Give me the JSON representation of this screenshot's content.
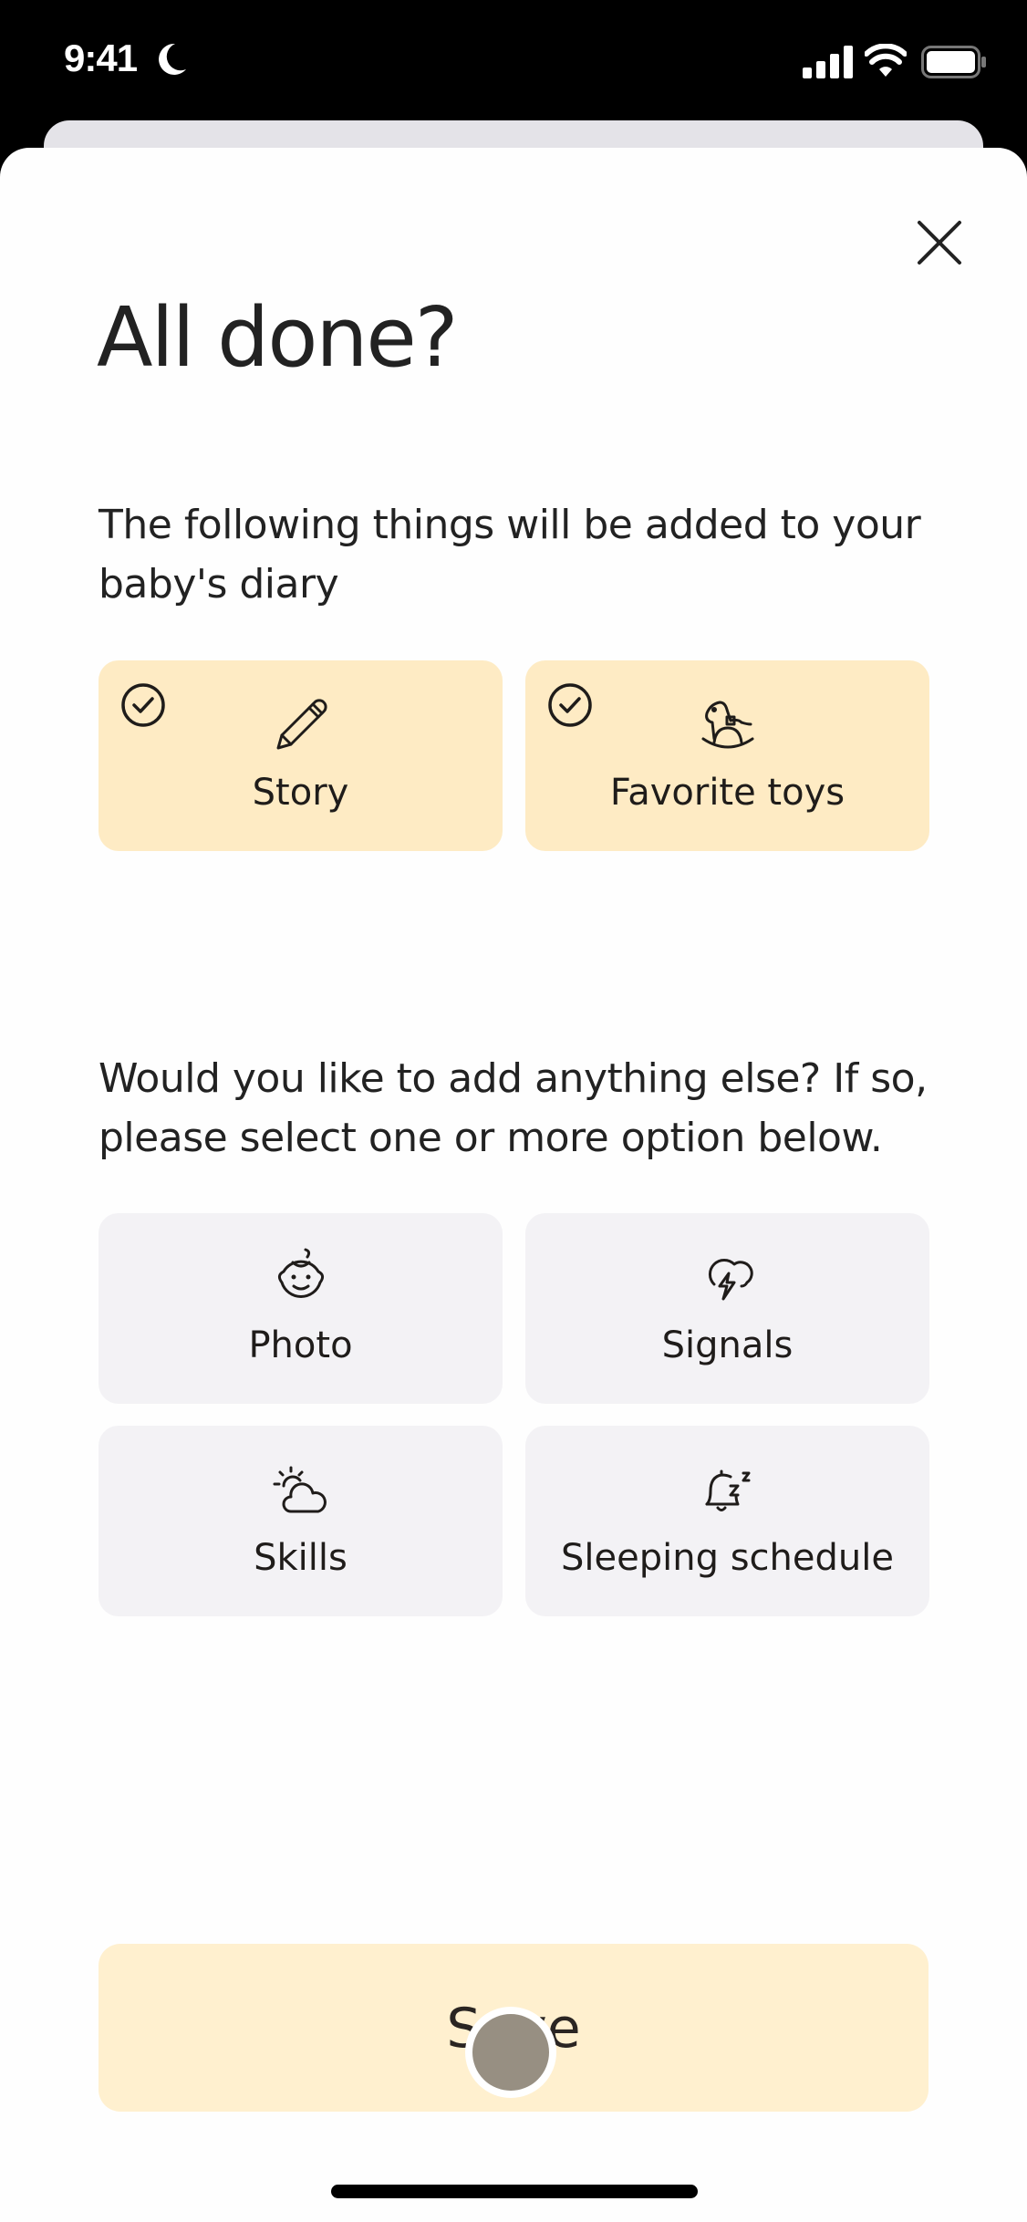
{
  "status_bar": {
    "time": "9:41",
    "icons": [
      "moon-icon",
      "cellular-signal-icon",
      "wifi-icon",
      "battery-icon"
    ]
  },
  "sheet": {
    "close_icon": "close-icon",
    "title": "All done?",
    "added_intro": "The following things will be added to your baby's diary",
    "added_items": [
      {
        "label": "Story",
        "icon": "pencil-icon",
        "selected": true
      },
      {
        "label": "Favorite toys",
        "icon": "rocking-horse-icon",
        "selected": true
      }
    ],
    "options_intro": "Would you like to add anything else? If so, please select one or more option below.",
    "options": [
      {
        "label": "Photo",
        "icon": "baby-face-icon",
        "selected": false
      },
      {
        "label": "Signals",
        "icon": "cloud-lightning-icon",
        "selected": false
      },
      {
        "label": "Skills",
        "icon": "sun-cloud-icon",
        "selected": false
      },
      {
        "label": "Sleeping schedule",
        "icon": "bell-sleep-icon",
        "selected": false
      }
    ],
    "save_label": "Save"
  },
  "colors": {
    "selected_card": "#feebc4",
    "option_card": "#f3f2f5",
    "save_button": "#fff0cf",
    "text": "#1f1c1a"
  }
}
